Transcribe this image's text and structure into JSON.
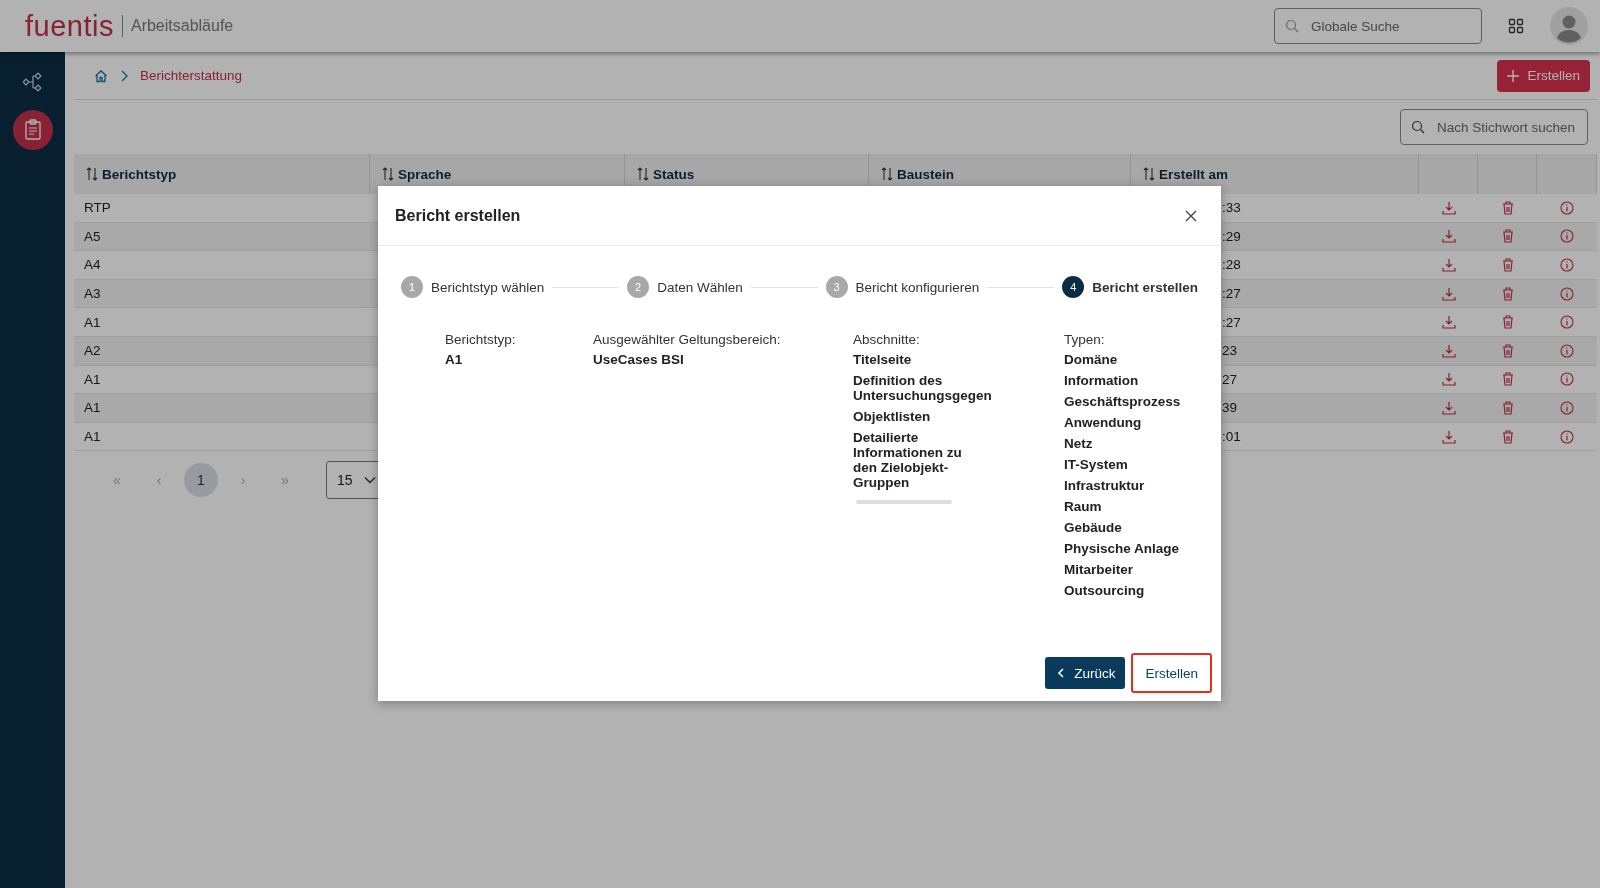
{
  "header": {
    "logo": "fuentis",
    "app_title": "Arbeitsabläufe",
    "search": {
      "placeholder": "Globale Suche"
    }
  },
  "sidebar": {
    "items": [
      {
        "kind": "flow",
        "selected": false
      },
      {
        "kind": "clipboard",
        "selected": true
      }
    ]
  },
  "breadcrumb": {
    "items": [
      "Berichterstattung"
    ]
  },
  "toolbar": {
    "create_button": "Erstellen",
    "keyword_search": {
      "placeholder": "Nach Stichwort suchen"
    }
  },
  "table": {
    "columns": [
      "Berichtstyp",
      "Sprache",
      "Status",
      "Baustein",
      "Erstellt am"
    ],
    "rows": [
      {
        "berichtstyp": "RTP",
        "erstellt_am": ":33"
      },
      {
        "berichtstyp": "A5",
        "erstellt_am": ":29"
      },
      {
        "berichtstyp": "A4",
        "erstellt_am": ":28"
      },
      {
        "berichtstyp": "A3",
        "erstellt_am": ":27"
      },
      {
        "berichtstyp": "A1",
        "erstellt_am": ":27"
      },
      {
        "berichtstyp": "A2",
        "erstellt_am": "23"
      },
      {
        "berichtstyp": "A1",
        "erstellt_am": "27"
      },
      {
        "berichtstyp": "A1",
        "erstellt_am": "39"
      },
      {
        "berichtstyp": "A1",
        "erstellt_am": ":01"
      }
    ]
  },
  "pagination": {
    "first": "«",
    "previous": "‹",
    "pages": [
      {
        "label": "1",
        "selected": true
      }
    ],
    "next": "›",
    "last": "»",
    "arrows_disabled": true,
    "page_size": "15"
  },
  "dialog": {
    "title": "Bericht erstellen",
    "steps": [
      {
        "number": "1",
        "label": "Berichtstyp wählen",
        "selected": false
      },
      {
        "number": "2",
        "label": "Daten Wählen",
        "selected": false
      },
      {
        "number": "3",
        "label": "Bericht konfigurieren",
        "selected": false
      },
      {
        "number": "4",
        "label": "Bericht erstellen",
        "selected": true
      }
    ],
    "summary": [
      {
        "label": "Berichtstyp:",
        "values": [
          "A1"
        ],
        "scrollable": false
      },
      {
        "label": "Ausgewählter Geltungsbereich:",
        "values": [
          "UseCases BSI"
        ],
        "scrollable": false
      },
      {
        "label": "Abschnitte:",
        "values": [
          "Titelseite",
          "Definition des Untersuchungsgegen",
          "Objektlisten",
          "Detailierte Informationen zu den Zielobjekt-Gruppen"
        ],
        "scrollable": true
      },
      {
        "label": "Typen:",
        "values": [
          "Domäne",
          "Information",
          "Geschäftsprozess",
          "Anwendung",
          "Netz",
          "IT-System",
          "Infrastruktur",
          "Raum",
          "Gebäude",
          "Physische Anlage",
          "Mitarbeiter",
          "Outsourcing"
        ],
        "scrollable": false
      }
    ],
    "buttons": [
      {
        "kind": "back",
        "label": "Zurück",
        "highlighted": false
      },
      {
        "kind": "create",
        "label": "Erstellen",
        "highlighted": true
      }
    ]
  }
}
